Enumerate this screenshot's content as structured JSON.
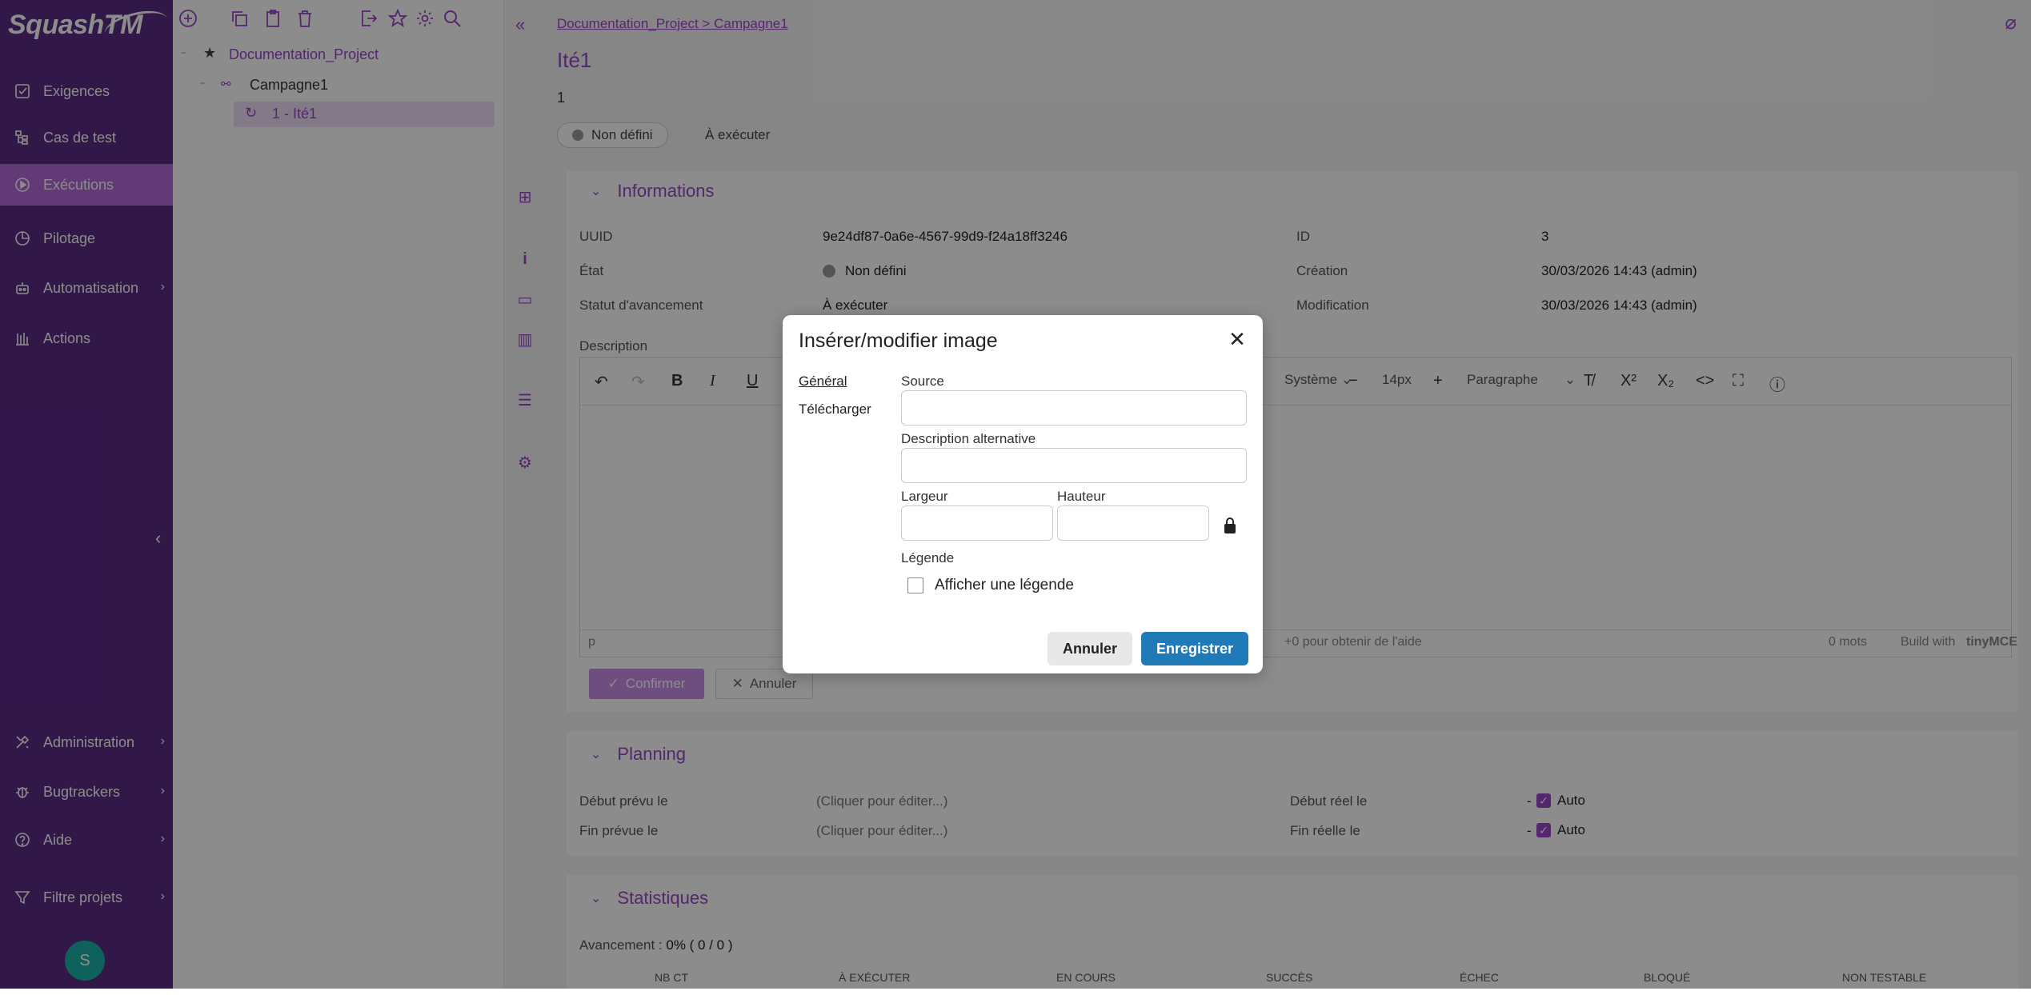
{
  "colors": {
    "brand": "#5b2a86",
    "accent": "#9c45c9",
    "active_nav": "#b36bd6",
    "primary_button": "#207ab7"
  },
  "nav": {
    "logo": "SquashTM",
    "items": [
      {
        "label": "Exigences",
        "icon": "requirements-icon"
      },
      {
        "label": "Cas de test",
        "icon": "test-cases-icon"
      },
      {
        "label": "Exécutions",
        "icon": "executions-icon"
      },
      {
        "label": "Pilotage",
        "icon": "pilotage-icon"
      },
      {
        "label": "Automatisation",
        "icon": "automation-icon"
      },
      {
        "label": "Actions",
        "icon": "actions-icon"
      },
      {
        "label": "Administration",
        "icon": "administration-icon"
      },
      {
        "label": "Bugtrackers",
        "icon": "bugtracker-icon"
      },
      {
        "label": "Aide",
        "icon": "help-icon"
      },
      {
        "label": "Filtre projets",
        "icon": "filter-icon"
      }
    ],
    "avatar": "S"
  },
  "tree": {
    "project": "Documentation_Project",
    "campaign": "Campagne1",
    "iteration": "1 - Ité1"
  },
  "main": {
    "breadcrumb": "Documentation_Project > Campagne1",
    "title": "Ité1",
    "reference": "1",
    "status_chip": "Non défini",
    "progress_chip": "À exécuter",
    "informations": {
      "title": "Informations",
      "uuid_label": "UUID",
      "uuid_value": "9e24df87-0a6e-4567-99d9-f24a18ff3246",
      "id_label": "ID",
      "id_value": "3",
      "state_label": "État",
      "state_value": "Non défini",
      "creation_label": "Création",
      "creation_value": "30/03/2026 14:43 (admin)",
      "progress_label": "Statut d'avancement",
      "progress_value": "À exécuter",
      "modification_label": "Modification",
      "modification_value": "30/03/2026 14:43 (admin)",
      "description_label": "Description"
    },
    "editor": {
      "font_family": "Système",
      "font_size": "14px",
      "block_format": "Paragraphe",
      "status_path": "p",
      "help_hint": "+0 pour obtenir de l'aide",
      "word_count": "0 mots",
      "build_with": "Build with",
      "tinymce": "tinyMCE",
      "confirm": "Confirmer",
      "cancel": "Annuler"
    },
    "planning": {
      "title": "Planning",
      "start_planned_label": "Début prévu le",
      "start_planned_value": "(Cliquer pour éditer...)",
      "end_planned_label": "Fin prévue le",
      "end_planned_value": "(Cliquer pour éditer...)",
      "start_real_label": "Début réel le",
      "end_real_label": "Fin réelle le",
      "auto_label": "Auto",
      "dash": "-"
    },
    "statistics": {
      "title": "Statistiques",
      "progress_label": "Avancement :",
      "progress_value": "0% ( 0 / 0 )",
      "columns": [
        "NB CT",
        "À EXÉCUTER",
        "EN COURS",
        "SUCCÈS",
        "ÉCHEC",
        "BLOQUÉ",
        "NON TESTABLE"
      ]
    }
  },
  "modal": {
    "title": "Insérer/modifier image",
    "tabs": [
      "Général",
      "Télécharger"
    ],
    "source_label": "Source",
    "source_value": "",
    "alt_label": "Description alternative",
    "alt_value": "",
    "width_label": "Largeur",
    "width_value": "",
    "height_label": "Hauteur",
    "height_value": "",
    "caption_section": "Légende",
    "caption_checkbox": "Afficher une légende",
    "caption_checked": false,
    "cancel": "Annuler",
    "save": "Enregistrer"
  }
}
